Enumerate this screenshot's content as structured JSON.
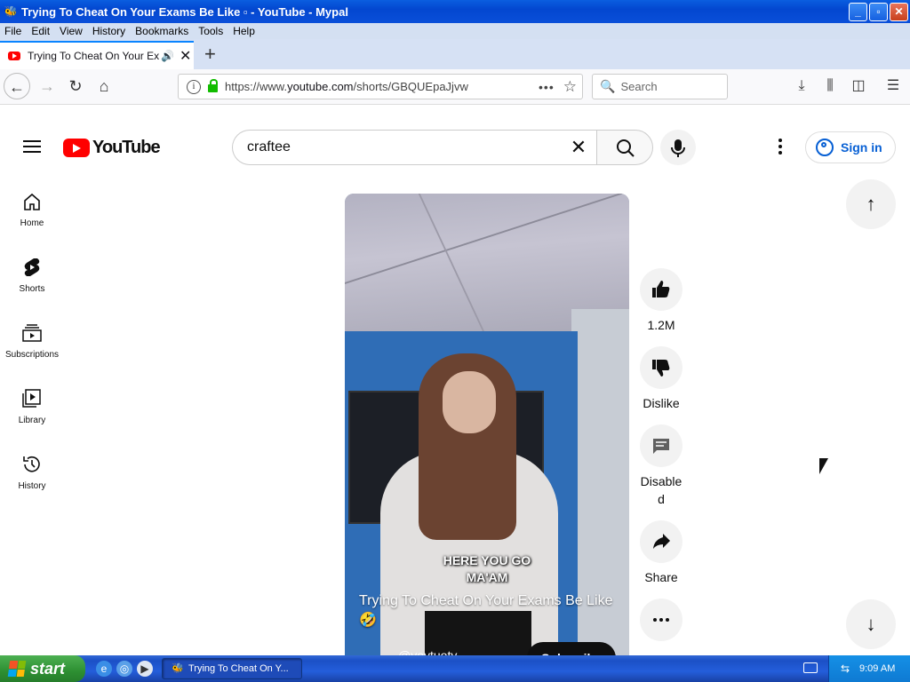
{
  "window": {
    "title": "Trying To Cheat On Your Exams Be Like ▫ - YouTube - Mypal"
  },
  "menu": [
    "File",
    "Edit",
    "View",
    "History",
    "Bookmarks",
    "Tools",
    "Help"
  ],
  "tab": {
    "title": "Trying To Cheat On Your Exam"
  },
  "address": {
    "url_prefix": "https://www.",
    "url_host": "youtube.com",
    "url_path": "/shorts/GBQUEpaJjvw"
  },
  "browser_search": {
    "placeholder": "Search"
  },
  "youtube": {
    "logo_text": "YouTube",
    "search_value": "craftee",
    "sign_in": "Sign in",
    "sidebar": [
      {
        "label": "Home",
        "icon": "home-icon"
      },
      {
        "label": "Shorts",
        "icon": "shorts-icon"
      },
      {
        "label": "Subscriptions",
        "icon": "subscriptions-icon"
      },
      {
        "label": "Library",
        "icon": "library-icon"
      },
      {
        "label": "History",
        "icon": "history-icon"
      }
    ]
  },
  "short": {
    "caption_line1": "HERE YOU GO",
    "caption_line2": "MA'AM",
    "title": "Trying To Cheat On Your Exams Be Like 🤣",
    "channel": "@yoytuoty",
    "subscribe": "Subscribe"
  },
  "actions": {
    "like_count": "1.2M",
    "dislike": "Dislike",
    "comments_line1": "Disable",
    "comments_line2": "d",
    "share": "Share"
  },
  "taskbar": {
    "start": "start",
    "task_item": "Trying To Cheat On Y...",
    "clock": "9:09 AM"
  },
  "colors": {
    "youtube_red": "#ff0000",
    "link_blue": "#065fd4",
    "xp_blue": "#245edb",
    "xp_green": "#2d8f32"
  }
}
